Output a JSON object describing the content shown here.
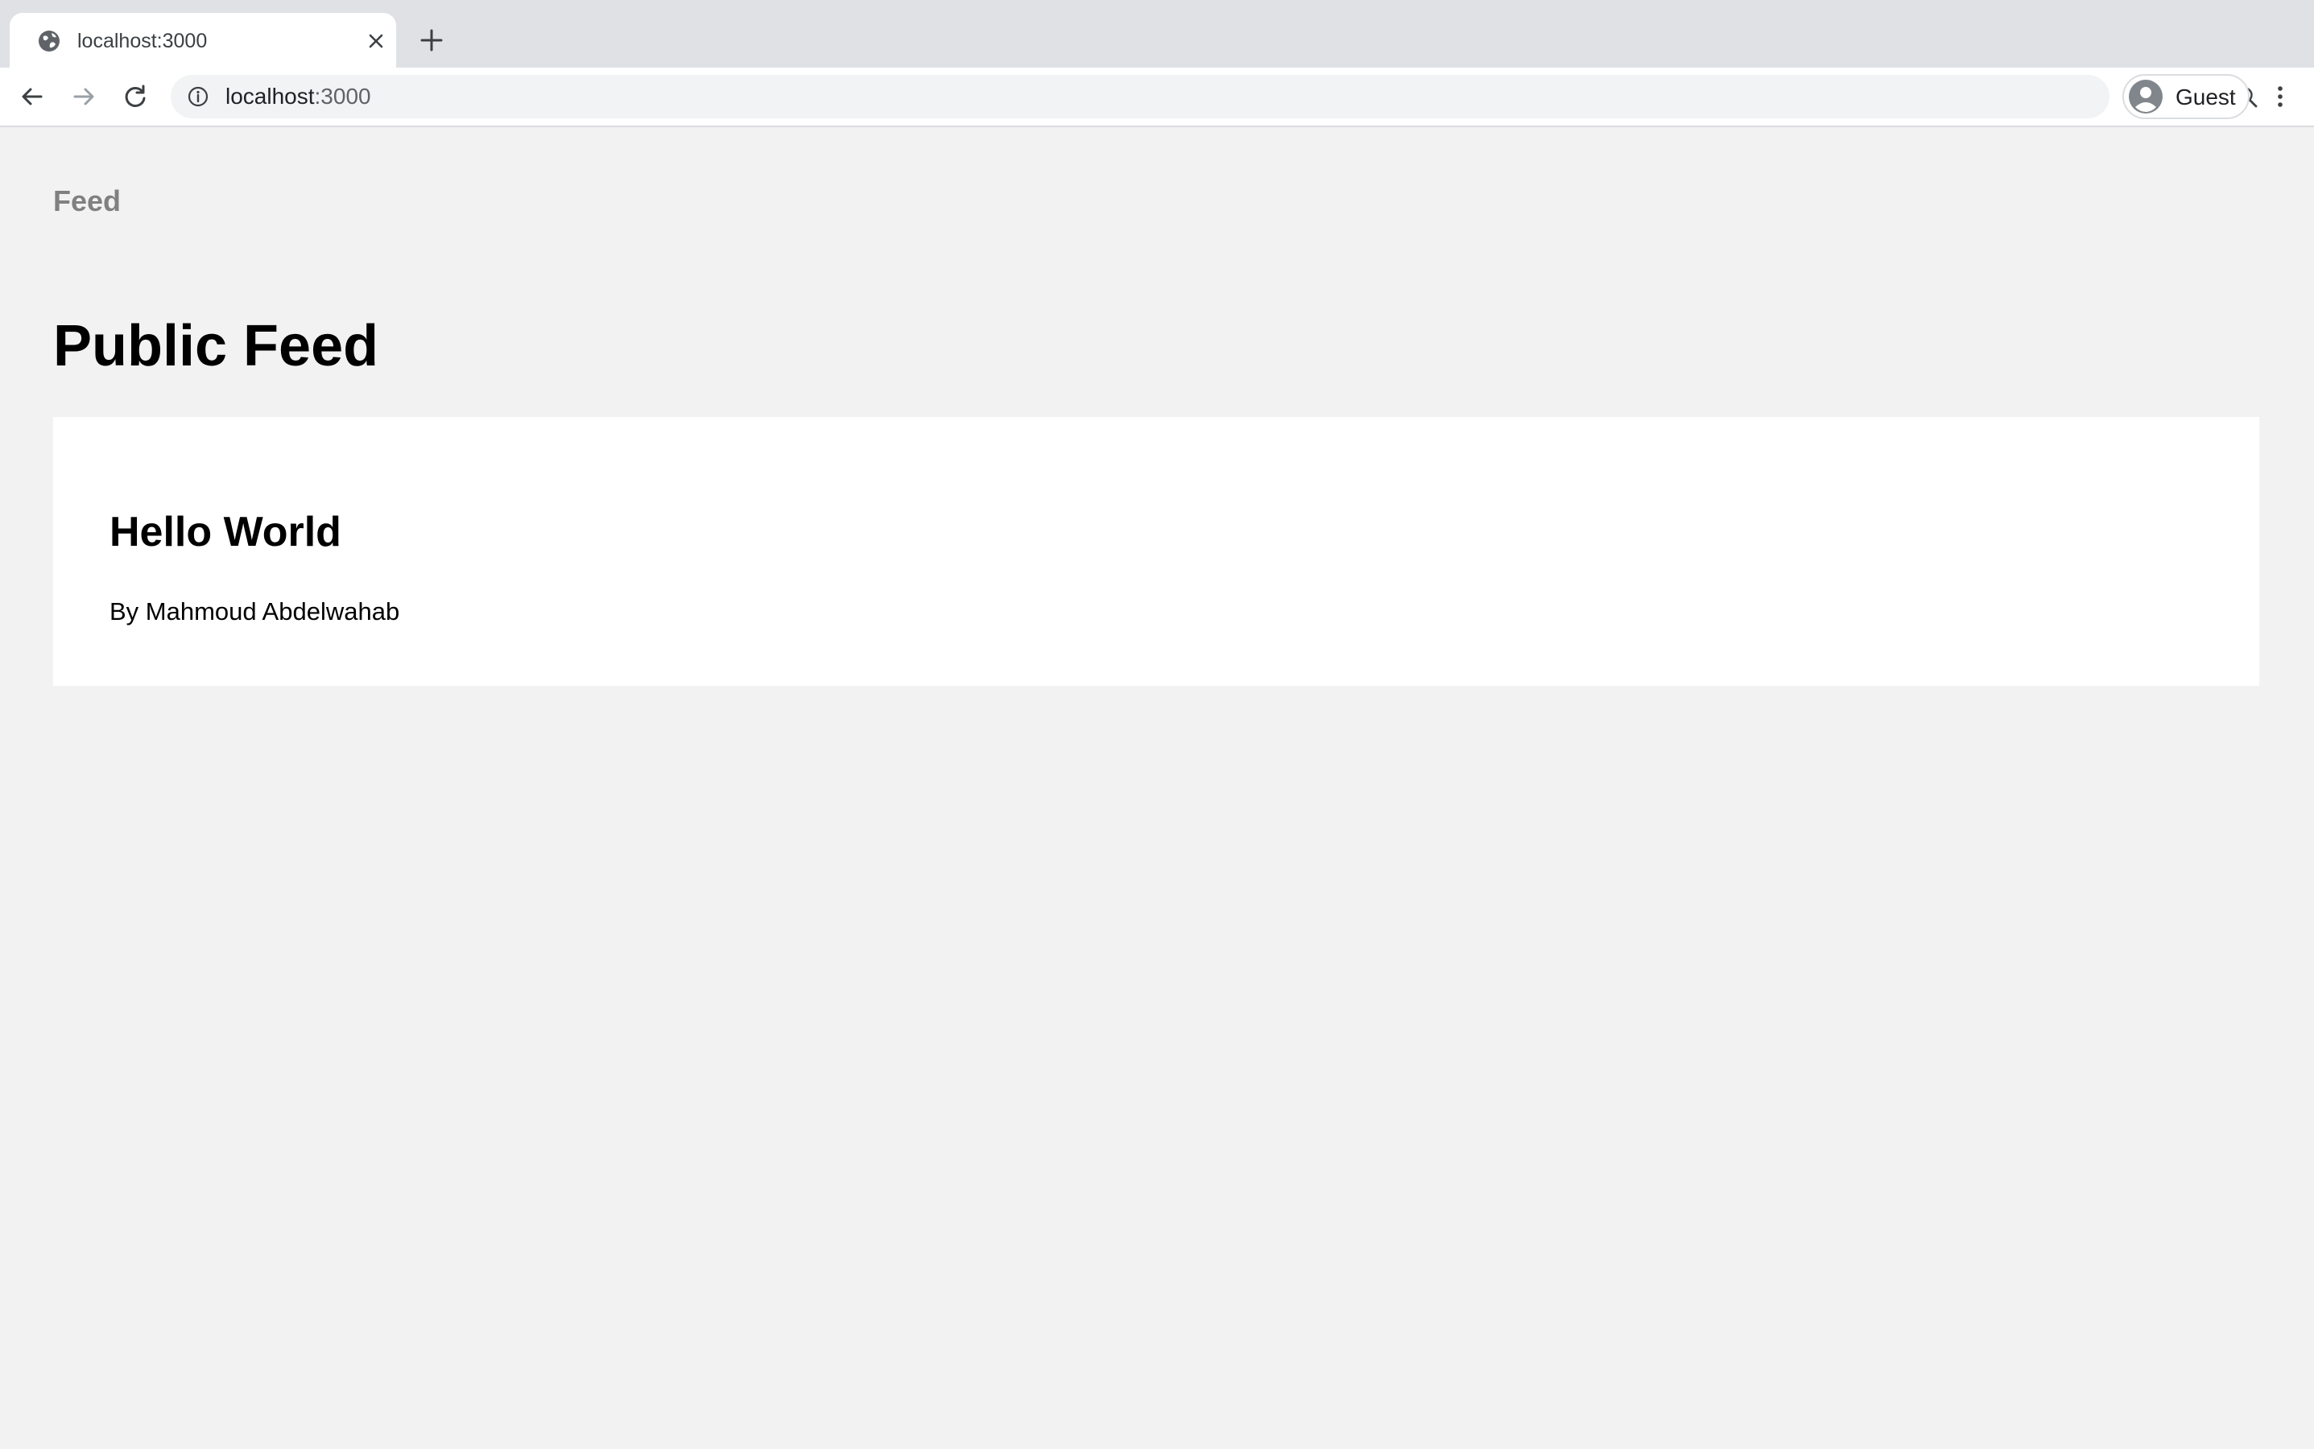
{
  "browser": {
    "tab": {
      "title": "localhost:3000"
    },
    "address_bar": {
      "host": "localhost",
      "port": ":3000"
    },
    "profile": {
      "label": "Guest"
    },
    "icons": {
      "tab_favicon": "globe-icon",
      "tab_close": "close-icon",
      "new_tab": "plus-icon",
      "back": "arrow-left-icon",
      "forward": "arrow-right-icon",
      "reload": "reload-icon",
      "site_info": "info-icon",
      "zoom": "zoom-in-icon",
      "avatar": "avatar-icon",
      "menu": "kebab-menu-icon"
    }
  },
  "page": {
    "nav": {
      "feed_link": "Feed"
    },
    "title": "Public Feed",
    "posts": [
      {
        "title": "Hello World",
        "author_line": "By Mahmoud Abdelwahab"
      }
    ]
  },
  "colors": {
    "page_background": "#f2f2f2",
    "card_background": "#ffffff",
    "nav_link": "#808080",
    "tabbar": "#dfe1e5"
  }
}
